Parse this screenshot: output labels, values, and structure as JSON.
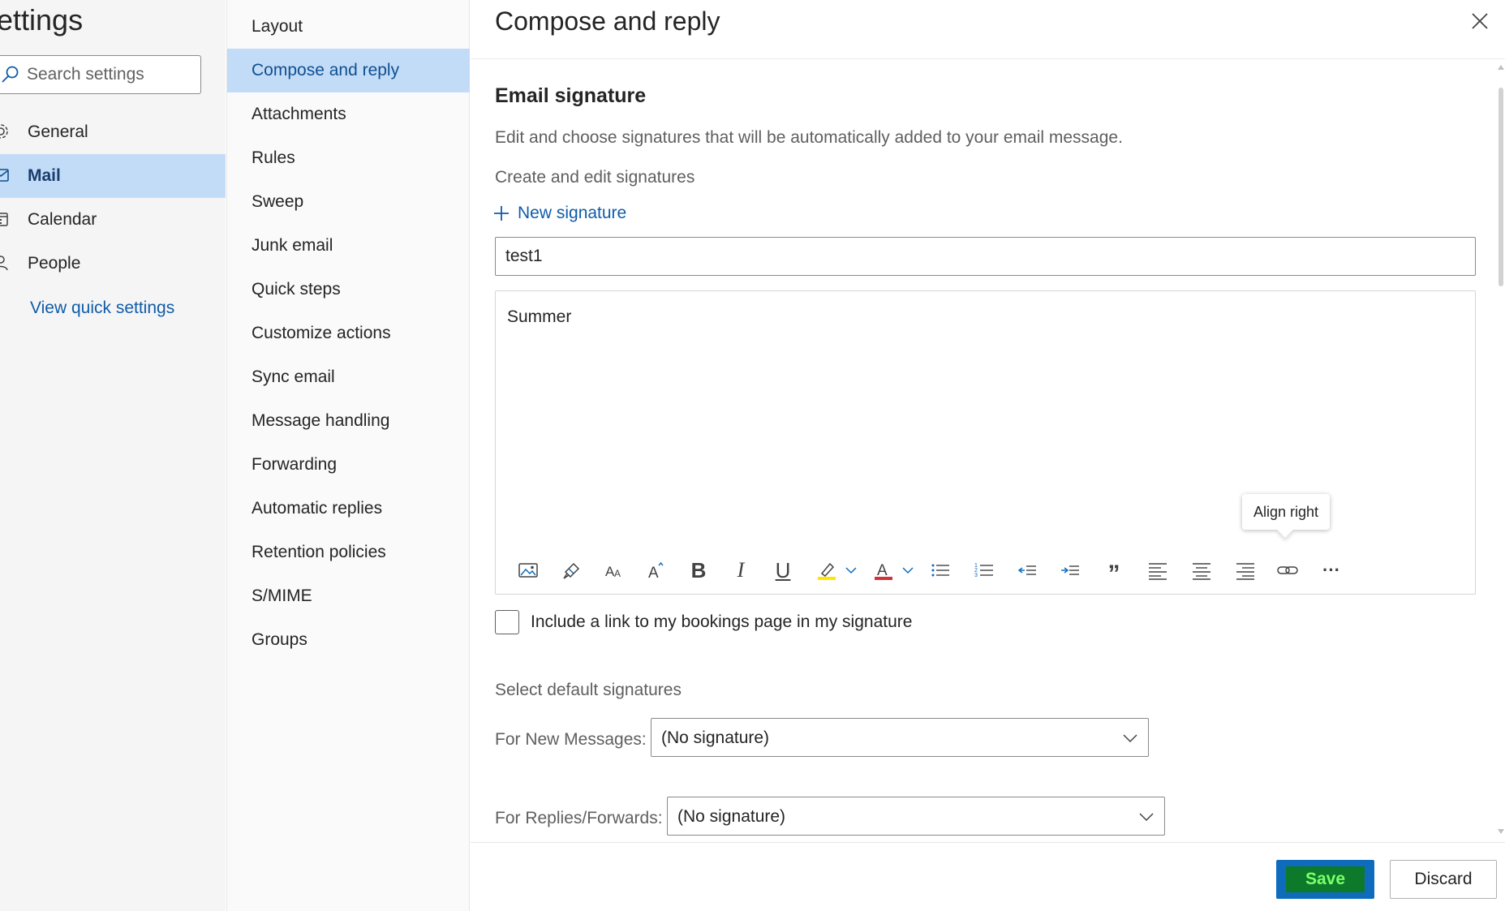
{
  "left": {
    "title": "ettings",
    "search_placeholder": "Search settings",
    "categories": [
      {
        "label": "General",
        "icon": "gear-icon"
      },
      {
        "label": "Mail",
        "icon": "mail-icon",
        "selected": true
      },
      {
        "label": "Calendar",
        "icon": "calendar-icon"
      },
      {
        "label": "People",
        "icon": "people-icon"
      }
    ],
    "quick_settings_link": "View quick settings"
  },
  "nav": {
    "items": [
      "Layout",
      "Compose and reply",
      "Attachments",
      "Rules",
      "Sweep",
      "Junk email",
      "Quick steps",
      "Customize actions",
      "Sync email",
      "Message handling",
      "Forwarding",
      "Automatic replies",
      "Retention policies",
      "S/MIME",
      "Groups"
    ],
    "selected": "Compose and reply"
  },
  "main": {
    "title": "Compose and reply",
    "section_title": "Email signature",
    "section_desc": "Edit and choose signatures that will be automatically added to your email message.",
    "create_label": "Create and edit signatures",
    "new_signature_label": "New signature",
    "signature_name": "test1",
    "editor_text": "Summer",
    "tooltip": "Align right",
    "toolbar": [
      "insert-picture-icon",
      "format-painter-icon",
      "font-size-icon",
      "font-size-increase-icon",
      "bold-icon",
      "italic-icon",
      "underline-icon",
      "highlight-icon",
      "font-color-icon",
      "bullets-icon",
      "numbering-icon",
      "decrease-indent-icon",
      "increase-indent-icon",
      "quote-icon",
      "align-left-icon",
      "align-center-icon",
      "align-right-icon",
      "link-icon",
      "more-icon"
    ],
    "toolbar_glyphs": {
      "bold": "B",
      "italic": "I",
      "underline": "U",
      "quote": "”",
      "more": "···"
    },
    "bookings_label": "Include a link to my bookings page in my signature",
    "defaults_label": "Select default signatures",
    "new_messages_label": "For New Messages:",
    "new_messages_value": "(No signature)",
    "replies_label": "For Replies/Forwards:",
    "replies_value": "(No signature)",
    "save_label": "Save",
    "discard_label": "Discard"
  },
  "colors": {
    "selected_bg": "#c2dcf7",
    "accent": "#0f6cbd",
    "link": "#0f5ca8",
    "highlight_yellow": "#ffe600",
    "font_color_red": "#d13438",
    "save_text_green": "#7dff6b",
    "save_text_bg": "#0c7a2a"
  }
}
